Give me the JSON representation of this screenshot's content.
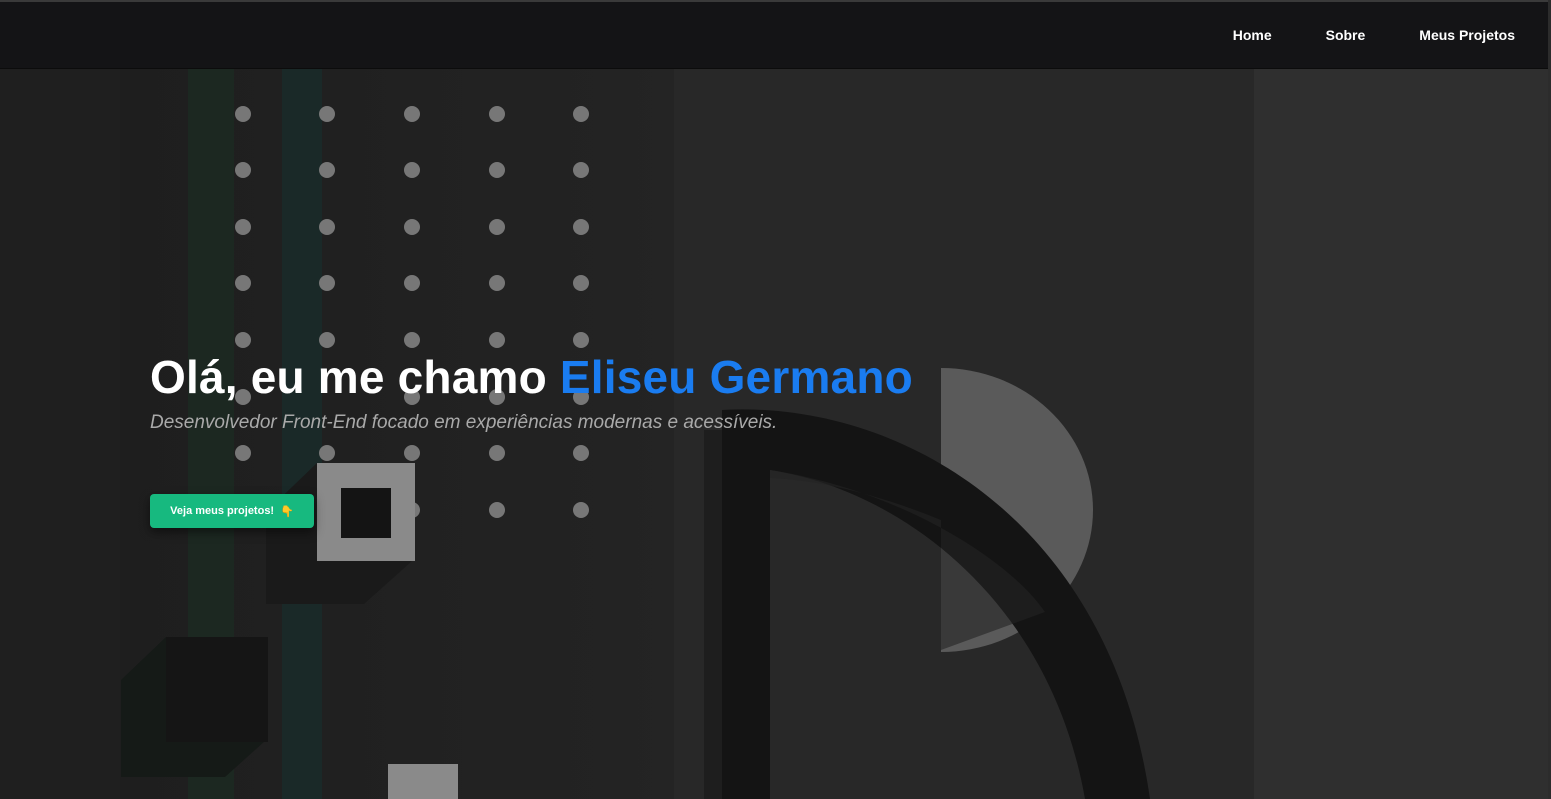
{
  "nav": {
    "links": [
      {
        "label": "Home"
      },
      {
        "label": "Sobre"
      },
      {
        "label": "Meus Projetos"
      }
    ]
  },
  "hero": {
    "title_prefix": "Olá, eu me chamo ",
    "title_name": "Eliseu Germano",
    "subtitle": "Desenvolvedor Front-End focado em experiências modernas e acessíveis.",
    "cta_label": "Veja meus projetos!",
    "cta_icon": "👇"
  },
  "colors": {
    "accent_blue": "#1a7cf0",
    "cta_green": "#17b97f",
    "navbar_bg": "#141416",
    "background": "#232323"
  },
  "icons": {
    "cta_icon_name": "pointing-down-hand-icon"
  }
}
